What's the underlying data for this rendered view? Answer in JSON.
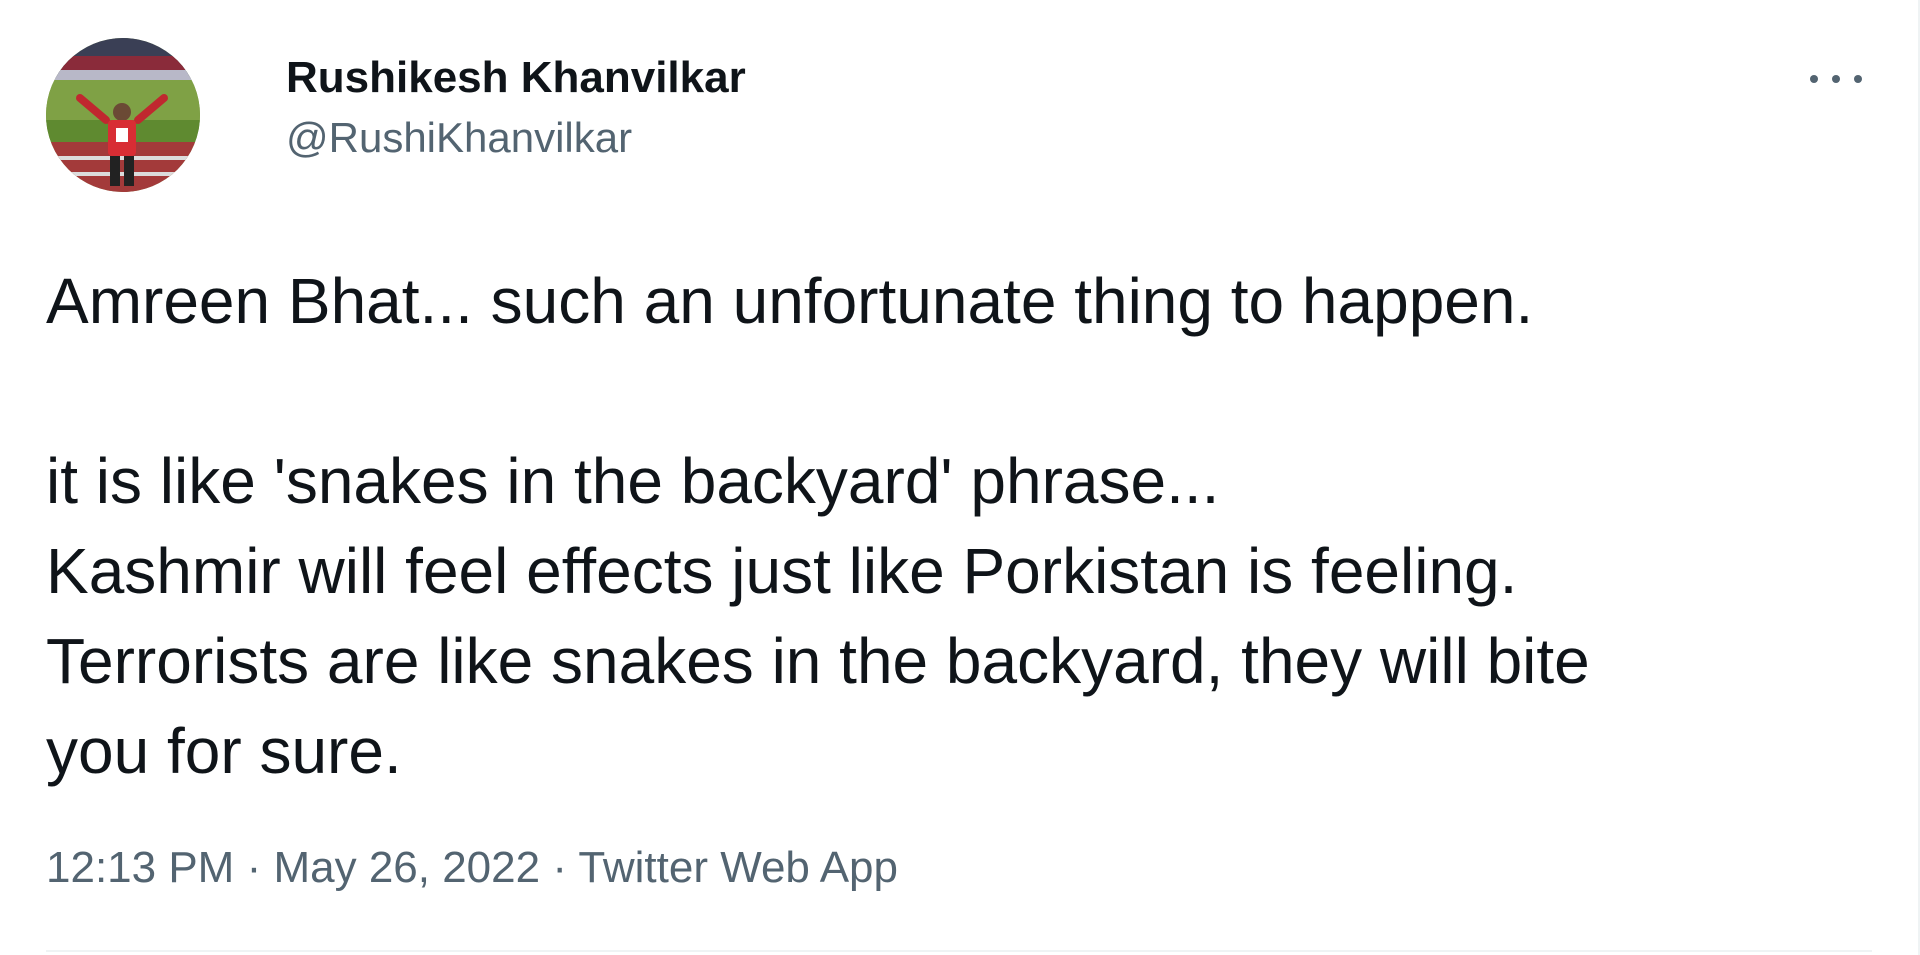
{
  "tweet": {
    "display_name": "Rushikesh Khanvilkar",
    "handle": "@RushiKhanvilkar",
    "avatar_icon": "profile-photo-stadium",
    "more_icon": "more-options-icon",
    "text_lines": [
      "Amreen Bhat... such an unfortunate thing to happen.",
      "it is like 'snakes in the backyard' phrase...",
      "Kashmir will feel effects just like Porkistan is feeling.",
      "Terrorists are like snakes in the backyard, they will bite",
      "you for sure."
    ],
    "time": "12:13 PM",
    "separator": "·",
    "date": "May 26, 2022",
    "source": "Twitter Web App"
  },
  "colors": {
    "primary_text": "#0f1419",
    "secondary_text": "#536471",
    "divider": "#eff3f4"
  }
}
